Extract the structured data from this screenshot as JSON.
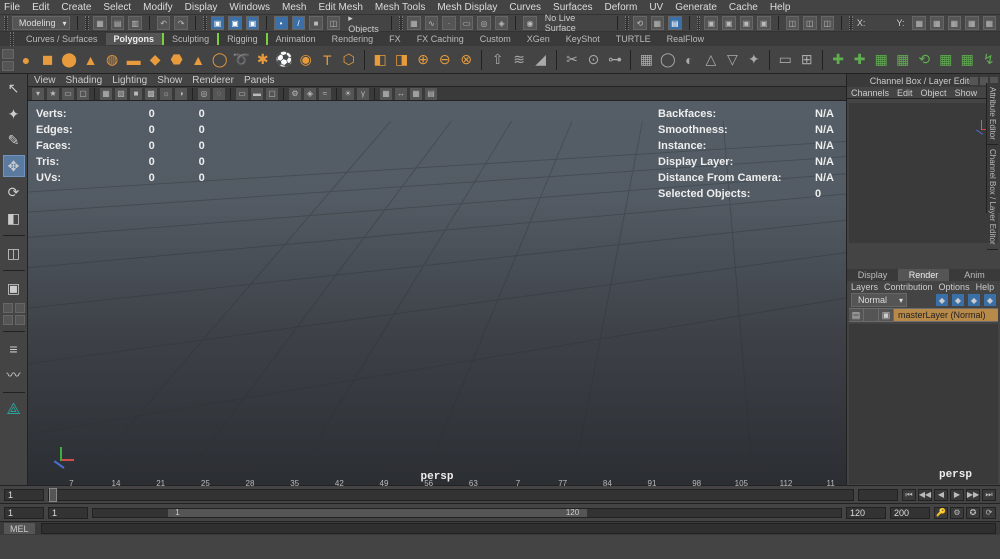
{
  "menubar": [
    "File",
    "Edit",
    "Create",
    "Select",
    "Modify",
    "Display",
    "Windows",
    "Mesh",
    "Edit Mesh",
    "Mesh Tools",
    "Mesh Display",
    "Curves",
    "Surfaces",
    "Deform",
    "UV",
    "Generate",
    "Cache",
    "Help"
  ],
  "workspace": "Modeling",
  "statusline": {
    "objects_label": "Objects",
    "no_live": "No Live Surface",
    "coord_x": "X:",
    "coord_y": "Y:"
  },
  "shelf_tabs": [
    {
      "label": "Curves / Surfaces",
      "active": false
    },
    {
      "label": "Polygons",
      "active": true
    },
    {
      "label": "Sculpting",
      "active": false,
      "glow": "both"
    },
    {
      "label": "Rigging",
      "active": false,
      "glow": "right"
    },
    {
      "label": "Animation",
      "active": false
    },
    {
      "label": "Rendering",
      "active": false
    },
    {
      "label": "FX",
      "active": false
    },
    {
      "label": "FX Caching",
      "active": false
    },
    {
      "label": "Custom",
      "active": false
    },
    {
      "label": "XGen",
      "active": false
    },
    {
      "label": "KeyShot",
      "active": false
    },
    {
      "label": "TURTLE",
      "active": false
    },
    {
      "label": "RealFlow",
      "active": false
    }
  ],
  "panel_menus": [
    "View",
    "Shading",
    "Lighting",
    "Show",
    "Renderer",
    "Panels"
  ],
  "hud_left": [
    {
      "label": "Verts:",
      "a": "0",
      "b": "0"
    },
    {
      "label": "Edges:",
      "a": "0",
      "b": "0"
    },
    {
      "label": "Faces:",
      "a": "0",
      "b": "0"
    },
    {
      "label": "Tris:",
      "a": "0",
      "b": "0"
    },
    {
      "label": "UVs:",
      "a": "0",
      "b": "0"
    }
  ],
  "hud_right": [
    {
      "label": "Backfaces:",
      "val": "N/A"
    },
    {
      "label": "Smoothness:",
      "val": "N/A"
    },
    {
      "label": "Instance:",
      "val": "N/A"
    },
    {
      "label": "Display Layer:",
      "val": "N/A"
    },
    {
      "label": "Distance From Camera:",
      "val": "N/A"
    },
    {
      "label": "Selected Objects:",
      "val": "0"
    }
  ],
  "camera_name": "persp",
  "channel_box": {
    "title": "Channel Box / Layer Editor",
    "tabs": [
      "Channels",
      "Edit",
      "Object",
      "Show"
    ]
  },
  "side_tabs": [
    "Attribute Editor",
    "Channel Box / Layer Editor"
  ],
  "layers": {
    "tabs": [
      "Display",
      "Render",
      "Anim"
    ],
    "active": "Render",
    "subtabs": [
      "Layers",
      "Contribution",
      "Options",
      "Help"
    ],
    "mode": "Normal",
    "row": "masterLayer  (Normal)"
  },
  "time": {
    "ticks": [
      "7",
      "14",
      "21",
      "25",
      "28",
      "35",
      "42",
      "49",
      "56",
      "63",
      "7",
      "77",
      "84",
      "91",
      "98",
      "105",
      "112",
      "11"
    ],
    "current": "1",
    "range_start": "1",
    "range_end": "120",
    "range_outer_start": "1",
    "range_outer_end": "200",
    "display_end": "120"
  },
  "cmd_lang": "MEL"
}
